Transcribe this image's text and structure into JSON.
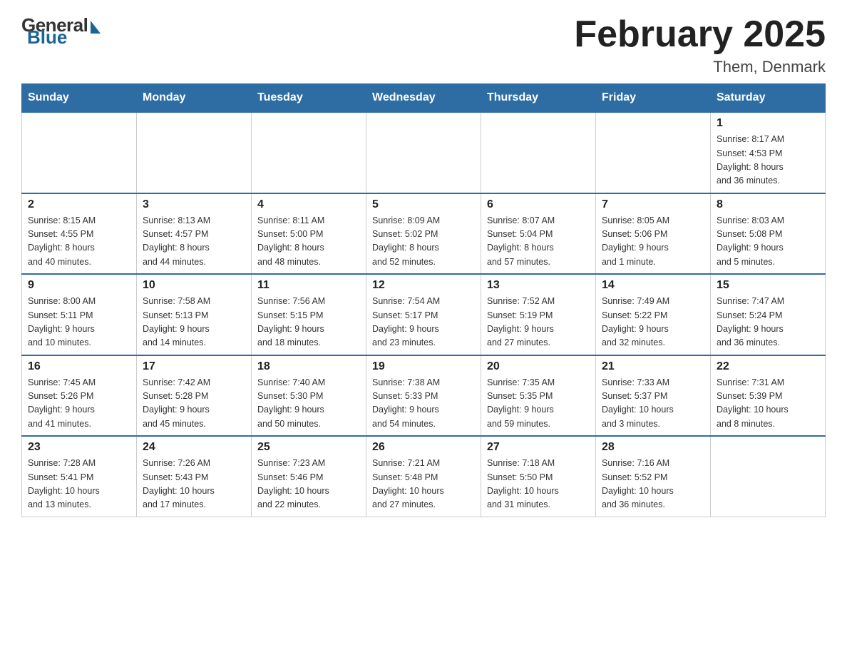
{
  "header": {
    "title": "February 2025",
    "location": "Them, Denmark",
    "logo_general": "General",
    "logo_blue": "Blue"
  },
  "weekdays": [
    "Sunday",
    "Monday",
    "Tuesday",
    "Wednesday",
    "Thursday",
    "Friday",
    "Saturday"
  ],
  "weeks": [
    [
      {
        "day": "",
        "info": ""
      },
      {
        "day": "",
        "info": ""
      },
      {
        "day": "",
        "info": ""
      },
      {
        "day": "",
        "info": ""
      },
      {
        "day": "",
        "info": ""
      },
      {
        "day": "",
        "info": ""
      },
      {
        "day": "1",
        "info": "Sunrise: 8:17 AM\nSunset: 4:53 PM\nDaylight: 8 hours\nand 36 minutes."
      }
    ],
    [
      {
        "day": "2",
        "info": "Sunrise: 8:15 AM\nSunset: 4:55 PM\nDaylight: 8 hours\nand 40 minutes."
      },
      {
        "day": "3",
        "info": "Sunrise: 8:13 AM\nSunset: 4:57 PM\nDaylight: 8 hours\nand 44 minutes."
      },
      {
        "day": "4",
        "info": "Sunrise: 8:11 AM\nSunset: 5:00 PM\nDaylight: 8 hours\nand 48 minutes."
      },
      {
        "day": "5",
        "info": "Sunrise: 8:09 AM\nSunset: 5:02 PM\nDaylight: 8 hours\nand 52 minutes."
      },
      {
        "day": "6",
        "info": "Sunrise: 8:07 AM\nSunset: 5:04 PM\nDaylight: 8 hours\nand 57 minutes."
      },
      {
        "day": "7",
        "info": "Sunrise: 8:05 AM\nSunset: 5:06 PM\nDaylight: 9 hours\nand 1 minute."
      },
      {
        "day": "8",
        "info": "Sunrise: 8:03 AM\nSunset: 5:08 PM\nDaylight: 9 hours\nand 5 minutes."
      }
    ],
    [
      {
        "day": "9",
        "info": "Sunrise: 8:00 AM\nSunset: 5:11 PM\nDaylight: 9 hours\nand 10 minutes."
      },
      {
        "day": "10",
        "info": "Sunrise: 7:58 AM\nSunset: 5:13 PM\nDaylight: 9 hours\nand 14 minutes."
      },
      {
        "day": "11",
        "info": "Sunrise: 7:56 AM\nSunset: 5:15 PM\nDaylight: 9 hours\nand 18 minutes."
      },
      {
        "day": "12",
        "info": "Sunrise: 7:54 AM\nSunset: 5:17 PM\nDaylight: 9 hours\nand 23 minutes."
      },
      {
        "day": "13",
        "info": "Sunrise: 7:52 AM\nSunset: 5:19 PM\nDaylight: 9 hours\nand 27 minutes."
      },
      {
        "day": "14",
        "info": "Sunrise: 7:49 AM\nSunset: 5:22 PM\nDaylight: 9 hours\nand 32 minutes."
      },
      {
        "day": "15",
        "info": "Sunrise: 7:47 AM\nSunset: 5:24 PM\nDaylight: 9 hours\nand 36 minutes."
      }
    ],
    [
      {
        "day": "16",
        "info": "Sunrise: 7:45 AM\nSunset: 5:26 PM\nDaylight: 9 hours\nand 41 minutes."
      },
      {
        "day": "17",
        "info": "Sunrise: 7:42 AM\nSunset: 5:28 PM\nDaylight: 9 hours\nand 45 minutes."
      },
      {
        "day": "18",
        "info": "Sunrise: 7:40 AM\nSunset: 5:30 PM\nDaylight: 9 hours\nand 50 minutes."
      },
      {
        "day": "19",
        "info": "Sunrise: 7:38 AM\nSunset: 5:33 PM\nDaylight: 9 hours\nand 54 minutes."
      },
      {
        "day": "20",
        "info": "Sunrise: 7:35 AM\nSunset: 5:35 PM\nDaylight: 9 hours\nand 59 minutes."
      },
      {
        "day": "21",
        "info": "Sunrise: 7:33 AM\nSunset: 5:37 PM\nDaylight: 10 hours\nand 3 minutes."
      },
      {
        "day": "22",
        "info": "Sunrise: 7:31 AM\nSunset: 5:39 PM\nDaylight: 10 hours\nand 8 minutes."
      }
    ],
    [
      {
        "day": "23",
        "info": "Sunrise: 7:28 AM\nSunset: 5:41 PM\nDaylight: 10 hours\nand 13 minutes."
      },
      {
        "day": "24",
        "info": "Sunrise: 7:26 AM\nSunset: 5:43 PM\nDaylight: 10 hours\nand 17 minutes."
      },
      {
        "day": "25",
        "info": "Sunrise: 7:23 AM\nSunset: 5:46 PM\nDaylight: 10 hours\nand 22 minutes."
      },
      {
        "day": "26",
        "info": "Sunrise: 7:21 AM\nSunset: 5:48 PM\nDaylight: 10 hours\nand 27 minutes."
      },
      {
        "day": "27",
        "info": "Sunrise: 7:18 AM\nSunset: 5:50 PM\nDaylight: 10 hours\nand 31 minutes."
      },
      {
        "day": "28",
        "info": "Sunrise: 7:16 AM\nSunset: 5:52 PM\nDaylight: 10 hours\nand 36 minutes."
      },
      {
        "day": "",
        "info": ""
      }
    ]
  ]
}
